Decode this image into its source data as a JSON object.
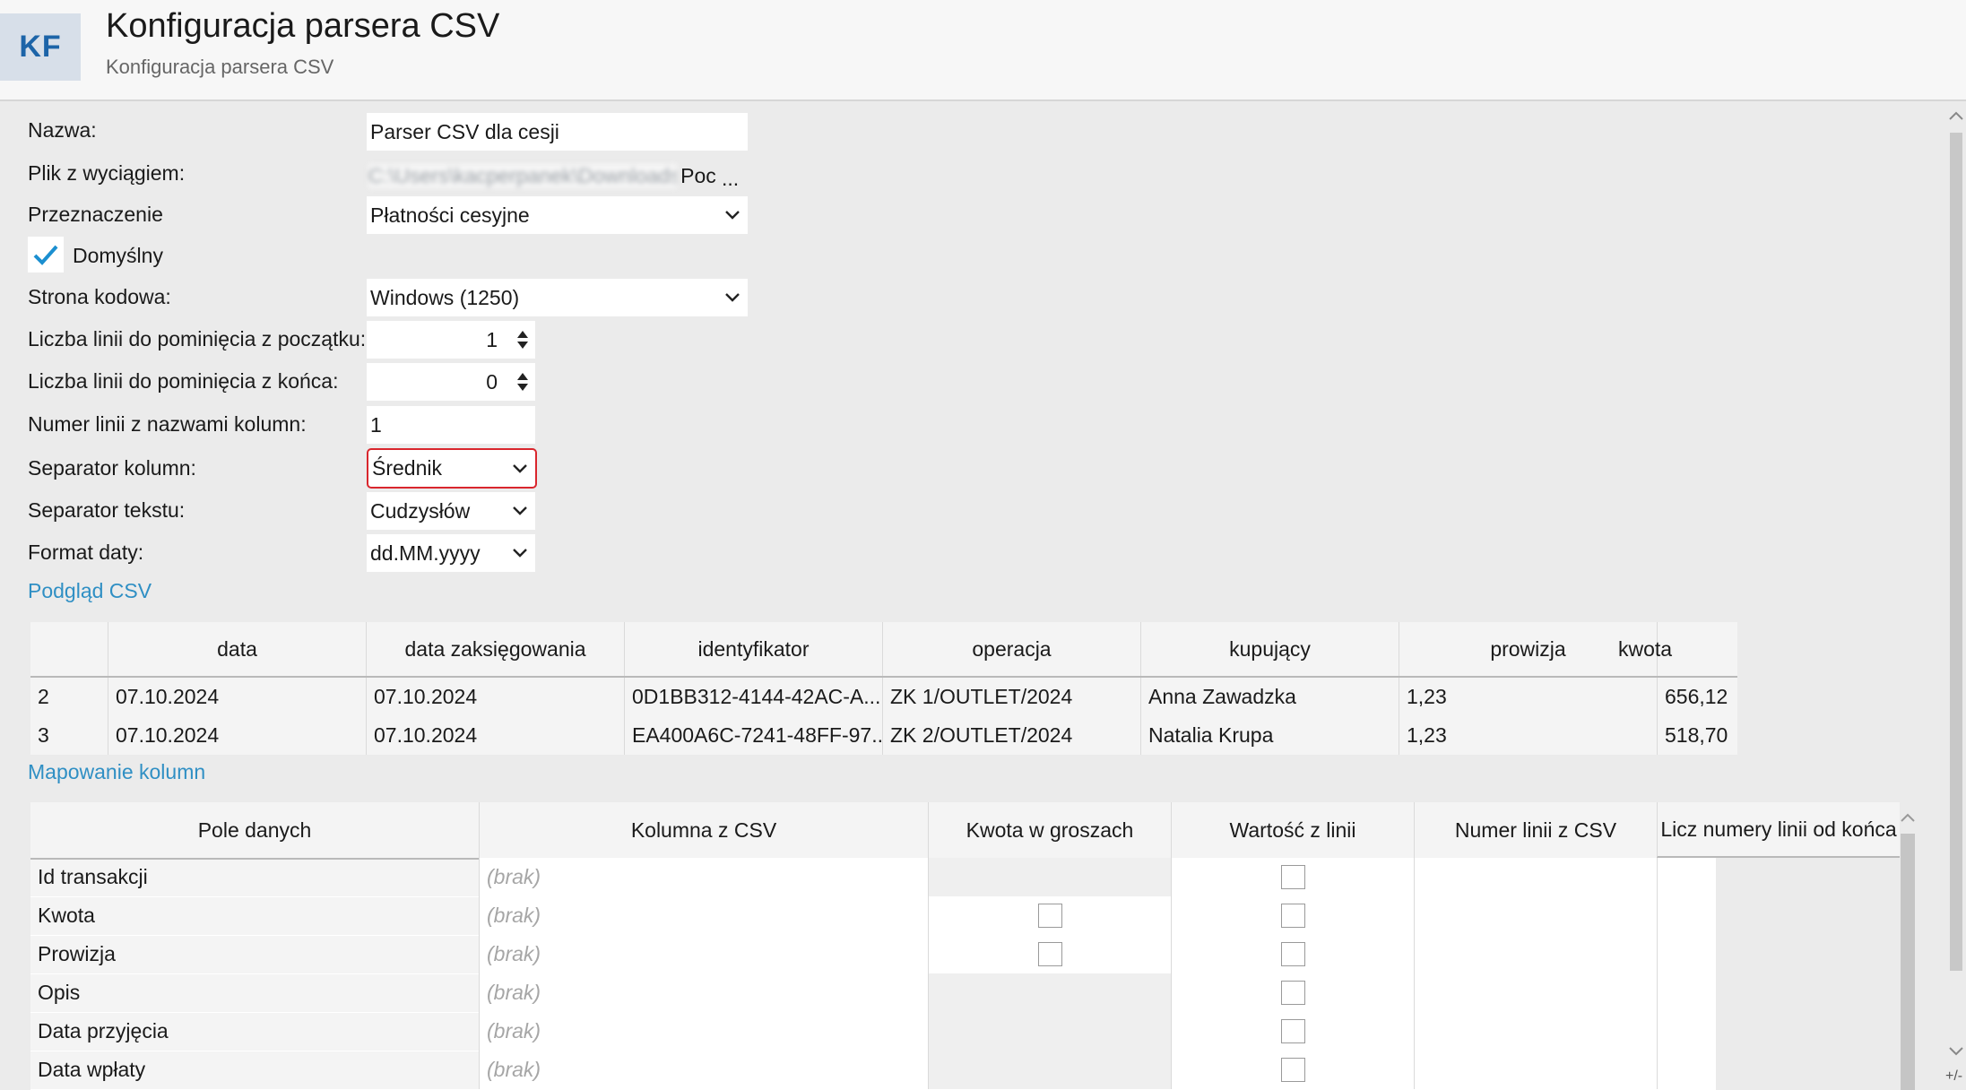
{
  "header": {
    "logo": "KF",
    "title": "Konfiguracja parsera CSV",
    "subtitle": "Konfiguracja parsera CSV"
  },
  "form": {
    "name_label": "Nazwa:",
    "name_value": "Parser CSV dla cesji",
    "file_label": "Plik z wyciągiem:",
    "file_path_blurred": "C:\\Users\\kacperpanek\\Downloads\\",
    "file_path_visible": "Pocz",
    "file_browse": "...",
    "purpose_label": "Przeznaczenie",
    "purpose_value": "Płatności cesyjne",
    "default_label": "Domyślny",
    "default_checked": true,
    "encoding_label": "Strona kodowa:",
    "encoding_value": "Windows (1250)",
    "skip_start_label": "Liczba linii do pominięcia z początku:",
    "skip_start_value": "1",
    "skip_end_label": "Liczba linii do pominięcia z końca:",
    "skip_end_value": "0",
    "header_line_label": "Numer linii z nazwami kolumn:",
    "header_line_value": "1",
    "col_sep_label": "Separator kolumn:",
    "col_sep_value": "Średnik",
    "text_sep_label": "Separator tekstu:",
    "text_sep_value": "Cudzysłów",
    "date_format_label": "Format daty:",
    "date_format_value": "dd.MM.yyyy"
  },
  "preview": {
    "section_title": "Podgląd CSV",
    "columns": [
      "",
      "data",
      "data zaksięgowania",
      "identyfikator",
      "operacja",
      "kupujący",
      "prowizja",
      "kwota"
    ],
    "rows": [
      [
        "2",
        "07.10.2024",
        "07.10.2024",
        "0D1BB312-4144-42AC-A...",
        "ZK 1/OUTLET/2024",
        "Anna Zawadzka",
        "1,23",
        "656,12"
      ],
      [
        "3",
        "07.10.2024",
        "07.10.2024",
        "EA400A6C-7241-48FF-97...",
        "ZK 2/OUTLET/2024",
        "Natalia Krupa",
        "1,23",
        "518,70"
      ]
    ]
  },
  "mapping": {
    "section_title": "Mapowanie kolumn",
    "columns": [
      "Pole danych",
      "Kolumna z CSV",
      "Kwota w groszach",
      "Wartość z linii",
      "Numer linii z CSV",
      "Licz numery linii od końca"
    ],
    "placeholder": "(brak)",
    "rows": [
      {
        "name": "Id transakcji",
        "kwota_cb": false
      },
      {
        "name": "Kwota",
        "kwota_cb": true
      },
      {
        "name": "Prowizja",
        "kwota_cb": true
      },
      {
        "name": "Opis",
        "kwota_cb": false
      },
      {
        "name": "Data przyjęcia",
        "kwota_cb": false
      },
      {
        "name": "Data wpłaty",
        "kwota_cb": false
      }
    ]
  },
  "status": {
    "corner_text": "+/-"
  },
  "colors": {
    "accent": "#2f8fc4",
    "highlight_border": "#d9262d",
    "logo_bg": "#d7dfe9",
    "logo_text": "#1c64a8"
  }
}
